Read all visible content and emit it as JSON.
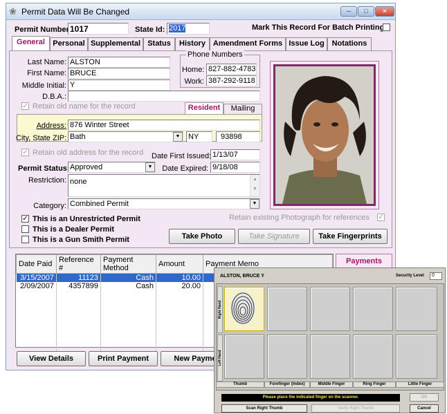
{
  "window": {
    "title": "Permit Data Will Be Changed",
    "buttons": [
      "minimize",
      "maximize",
      "close"
    ]
  },
  "header": {
    "permit_number_label": "Permit Number:",
    "permit_number": "1017",
    "state_id_label": "State Id:",
    "state_id": "2017",
    "batch_label": "Mark This Record For Batch Printing"
  },
  "tabs": [
    "General",
    "Personal",
    "Supplemental",
    "Status",
    "History",
    "Amendment Forms",
    "Issue Log",
    "Notations"
  ],
  "general": {
    "last_name_label": "Last Name:",
    "last_name": "ALSTON",
    "first_name_label": "First Name:",
    "first_name": "BRUCE",
    "middle_label": "Middle Initial:",
    "middle": "Y",
    "dba_label": "D.B.A.:",
    "dba": "",
    "phone_group": "Phone Numbers",
    "home_label": "Home:",
    "home": "827-882-4783",
    "work_label": "Work:",
    "work": "387-292-9118",
    "retain_name": "Retain old name for the record",
    "resident_tab": "Resident",
    "mailing_tab": "Mailing",
    "address_label": "Address:",
    "address": "876 Winter Street",
    "city_label": "City, State ZIP:",
    "city": "Bath",
    "state": "NY",
    "zip": "93898",
    "retain_address": "Retain old address for the record",
    "date_first_label": "Date First Issued:",
    "date_first": "1/13/07",
    "permit_status_label": "Permit Status:",
    "permit_status": "Approved",
    "date_expired_label": "Date Expired:",
    "date_expired": "9/18/08",
    "restriction_label": "Restriction:",
    "restriction": "none",
    "category_label": "Category:",
    "category": "Combined Permit",
    "unrestricted": "This is an Unrestricted Permit",
    "dealer": "This is a Dealer Permit",
    "gunsmith": "This is a Gun Smith Permit",
    "retain_photo": "Retain existing Photograph for references",
    "take_photo": "Take Photo",
    "take_signature": "Take Signature",
    "take_fingerprints": "Take Fingerprints"
  },
  "payments": {
    "columns": [
      "Date Paid",
      "Reference #",
      "Payment Method",
      "Amount",
      "Payment Memo"
    ],
    "rows": [
      {
        "date": "3/15/2007",
        "ref": "11123",
        "method": "Cash",
        "amount": "10.00",
        "memo": ""
      },
      {
        "date": "2/09/2007",
        "ref": "4357899",
        "method": "Cash",
        "amount": "20.00",
        "memo": ""
      }
    ],
    "payments_button": "Payments",
    "view_details": "View Details",
    "print_payment": "Print Payment",
    "new_payment": "New Payme"
  },
  "fingerprint": {
    "name": "ALSTON, BRUCE Y",
    "security_label": "Security Level",
    "security_value": "0",
    "right_hand": "Right Hand",
    "left_hand": "Left Hand",
    "fingers": [
      "Thumb",
      "Forefinger (Index)",
      "Middle Finger",
      "Ring Finger",
      "Little Finger"
    ],
    "instruction": "Please place the indicated finger on the scanner.",
    "ok": "OK",
    "scan": "Scan Right Thumb",
    "verify": "Verify Right Thumb",
    "cancel": "Cancel"
  }
}
